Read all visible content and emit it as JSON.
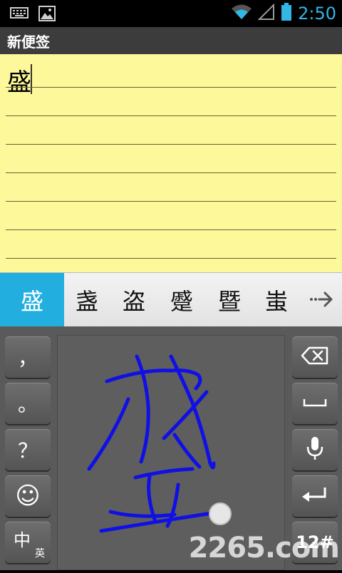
{
  "status_bar": {
    "time": "2:50",
    "icons": [
      "keyboard-icon",
      "image-notification-icon",
      "wifi-icon",
      "signal-icon",
      "battery-icon"
    ]
  },
  "title_bar": {
    "title": "新便签"
  },
  "note": {
    "text": "盛"
  },
  "candidates": {
    "selected": "盛",
    "items": [
      "盏",
      "盗",
      "蹙",
      "暨",
      "蚩"
    ]
  },
  "keyboard": {
    "comma_key": "，",
    "period_key": "。",
    "question_key": "？",
    "emoji_key": "☺",
    "lang_key_main": "中",
    "lang_key_sub": "英",
    "symbols_key": "12#"
  },
  "watermark": {
    "text": "2265.com"
  },
  "colors": {
    "accent": "#33b5e5",
    "candidate_selected": "#23aee0",
    "note_bg": "#fdf99b",
    "ink": "#1010e6"
  }
}
